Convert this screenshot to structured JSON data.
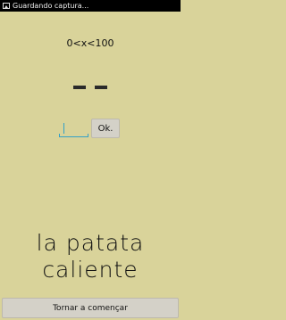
{
  "status_bar": {
    "notification_icon": "image-icon",
    "notification_text": "Guardando captura..."
  },
  "game": {
    "range_text": "0<x<100",
    "hidden_number_dashes": 2,
    "input": {
      "value": "",
      "placeholder": ""
    },
    "ok_label": "Ok.",
    "title_line1": "la patata",
    "title_line2": "caliente",
    "restart_label": "Tornar a començar"
  },
  "colors": {
    "background": "#d9d39a",
    "status_bar": "#000000",
    "input_accent": "#34a0c8",
    "button": "#d4d1c8"
  }
}
